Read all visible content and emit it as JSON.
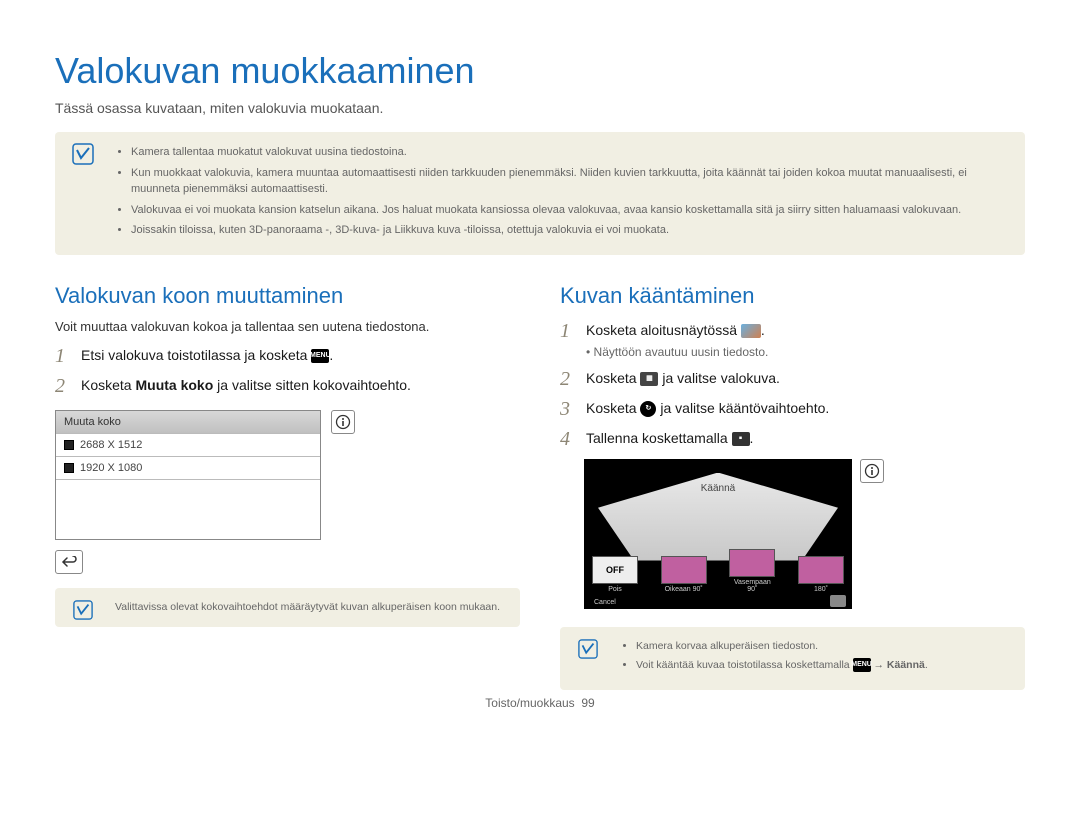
{
  "title": "Valokuvan muokkaaminen",
  "intro": "Tässä osassa kuvataan, miten valokuvia muokataan.",
  "topnote": {
    "items": [
      "Kamera tallentaa muokatut valokuvat uusina tiedostoina.",
      "Kun muokkaat valokuvia, kamera muuntaa automaattisesti niiden tarkkuuden pienemmäksi. Niiden kuvien tarkkuutta, joita käännät tai joiden kokoa muutat manuaalisesti, ei muunneta pienemmäksi automaattisesti.",
      "Valokuvaa ei voi muokata kansion katselun aikana. Jos haluat muokata kansiossa olevaa valokuvaa, avaa kansio koskettamalla sitä ja siirry sitten haluamaasi valokuvaan.",
      "Joissakin tiloissa, kuten 3D-panoraama -, 3D-kuva- ja Liikkuva kuva -tiloissa, otettuja valokuvia ei voi muokata."
    ]
  },
  "left": {
    "heading": "Valokuvan koon muuttaminen",
    "subtext": "Voit muuttaa valokuvan kokoa ja tallentaa sen uutena tiedostona.",
    "step1_pre": "Etsi valokuva toistotilassa ja kosketa ",
    "step1_post": ".",
    "step2_pre": "Kosketa ",
    "step2_bold": "Muuta koko",
    "step2_post": " ja valitse sitten kokovaihtoehto.",
    "menu_title": "Muuta koko",
    "menu_opt1": "2688 X 1512",
    "menu_opt2": "1920 X 1080",
    "note": "Valittavissa olevat kokovaihtoehdot määräytyvät kuvan alkuperäisen koon mukaan."
  },
  "right": {
    "heading": "Kuvan kääntäminen",
    "step1_pre": "Kosketa aloitusnäytössä ",
    "step1_post": ".",
    "step1_sub": "Näyttöön avautuu uusin tiedosto.",
    "step2_pre": "Kosketa ",
    "step2_post": " ja valitse valokuva.",
    "step3_pre": "Kosketa ",
    "step3_post": " ja valitse kääntövaihtoehto.",
    "step4_pre": "Tallenna koskettamalla ",
    "step4_post": ".",
    "ss_title": "Käännä",
    "thumbs": {
      "off": "OFF",
      "t0": "Pois",
      "t1": "Oikeaan 90˚",
      "t2": "Vasempaan 90˚",
      "t3": "180˚"
    },
    "cancel": "Cancel",
    "note1": "Kamera korvaa alkuperäisen tiedoston.",
    "note2_pre": "Voit kääntää kuvaa toistotilassa koskettamalla ",
    "note2_arrow": " → ",
    "note2_bold": "Käännä",
    "note2_post": "."
  },
  "footer": {
    "section": "Toisto/muokkaus",
    "page": "99"
  },
  "icons": {
    "menu": "MENU",
    "info": "ⓘ",
    "back": "↩",
    "rotate": "↻",
    "save": "💾"
  }
}
